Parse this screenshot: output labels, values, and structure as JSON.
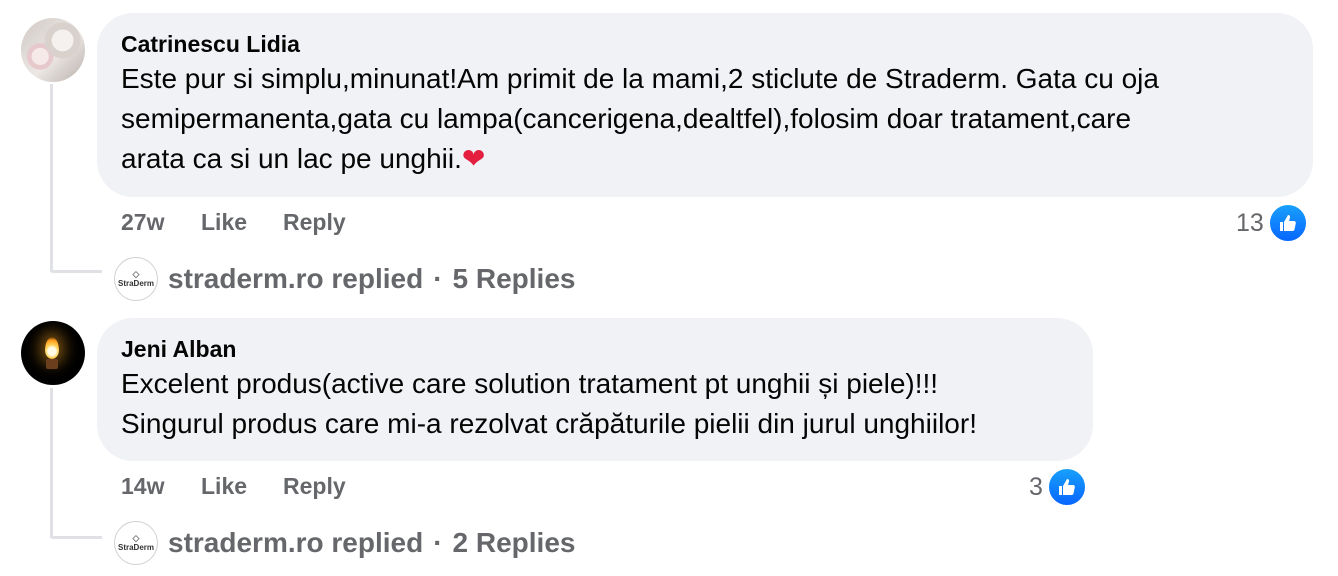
{
  "comments": [
    {
      "author": "Catrinescu Lidia",
      "lines": [
        "Este pur si simplu,minunat!Am primit de la mami,2 sticlute de Straderm. Gata cu oja",
        "semipermanenta,gata cu lampa(cancerigena,dealtfel),folosim doar tratament,care",
        "arata ca si un lac pe unghii."
      ],
      "emoji": "❤",
      "time": "27w",
      "like_label": "Like",
      "reply_label": "Reply",
      "reaction_count": "13",
      "replier": "straderm.ro replied",
      "replies_sep": "·",
      "replies_count": "5 Replies"
    },
    {
      "author": "Jeni Alban",
      "lines": [
        "Excelent produs(active care solution tratament pt unghii și piele)!!!",
        "Singurul produs care mi-a rezolvat crăpăturile pielii din jurul unghiilor!"
      ],
      "time": "14w",
      "like_label": "Like",
      "reply_label": "Reply",
      "reaction_count": "3",
      "replier": "straderm.ro replied",
      "replies_sep": "·",
      "replies_count": "2 Replies"
    }
  ],
  "brand_avatar_text": "StraDerm",
  "colors": {
    "bubble": "#f0f2f5",
    "meta": "#65676b",
    "like_blue": "#0866ff",
    "heart": "#e41e3f"
  }
}
